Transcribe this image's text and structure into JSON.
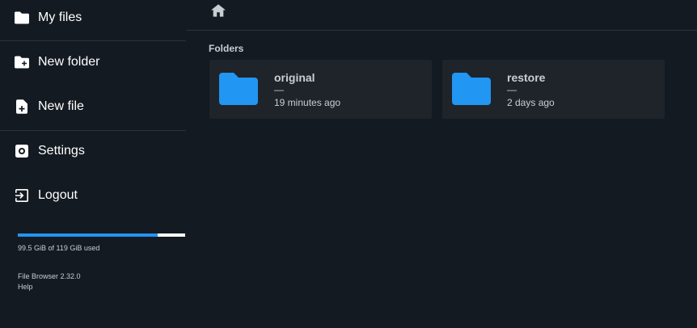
{
  "sidebar": {
    "items": [
      {
        "label": "My files",
        "icon": "folder-icon"
      },
      {
        "label": "New folder",
        "icon": "create-new-folder-icon"
      },
      {
        "label": "New file",
        "icon": "note-add-icon"
      },
      {
        "label": "Settings",
        "icon": "gear-icon"
      },
      {
        "label": "Logout",
        "icon": "logout-icon"
      }
    ],
    "usage": {
      "text": "99.5 GiB of 119 GiB used",
      "fraction": 0.836
    },
    "version": "File Browser 2.32.0",
    "help": "Help"
  },
  "main": {
    "section_title": "Folders",
    "folders": [
      {
        "name": "original",
        "size": "—",
        "modified": "19 minutes ago"
      },
      {
        "name": "restore",
        "size": "—",
        "modified": "2 days ago"
      }
    ]
  },
  "colors": {
    "background": "#141a21",
    "card": "#1e2429",
    "accent": "#2196f3",
    "text": "#c9ced3"
  }
}
